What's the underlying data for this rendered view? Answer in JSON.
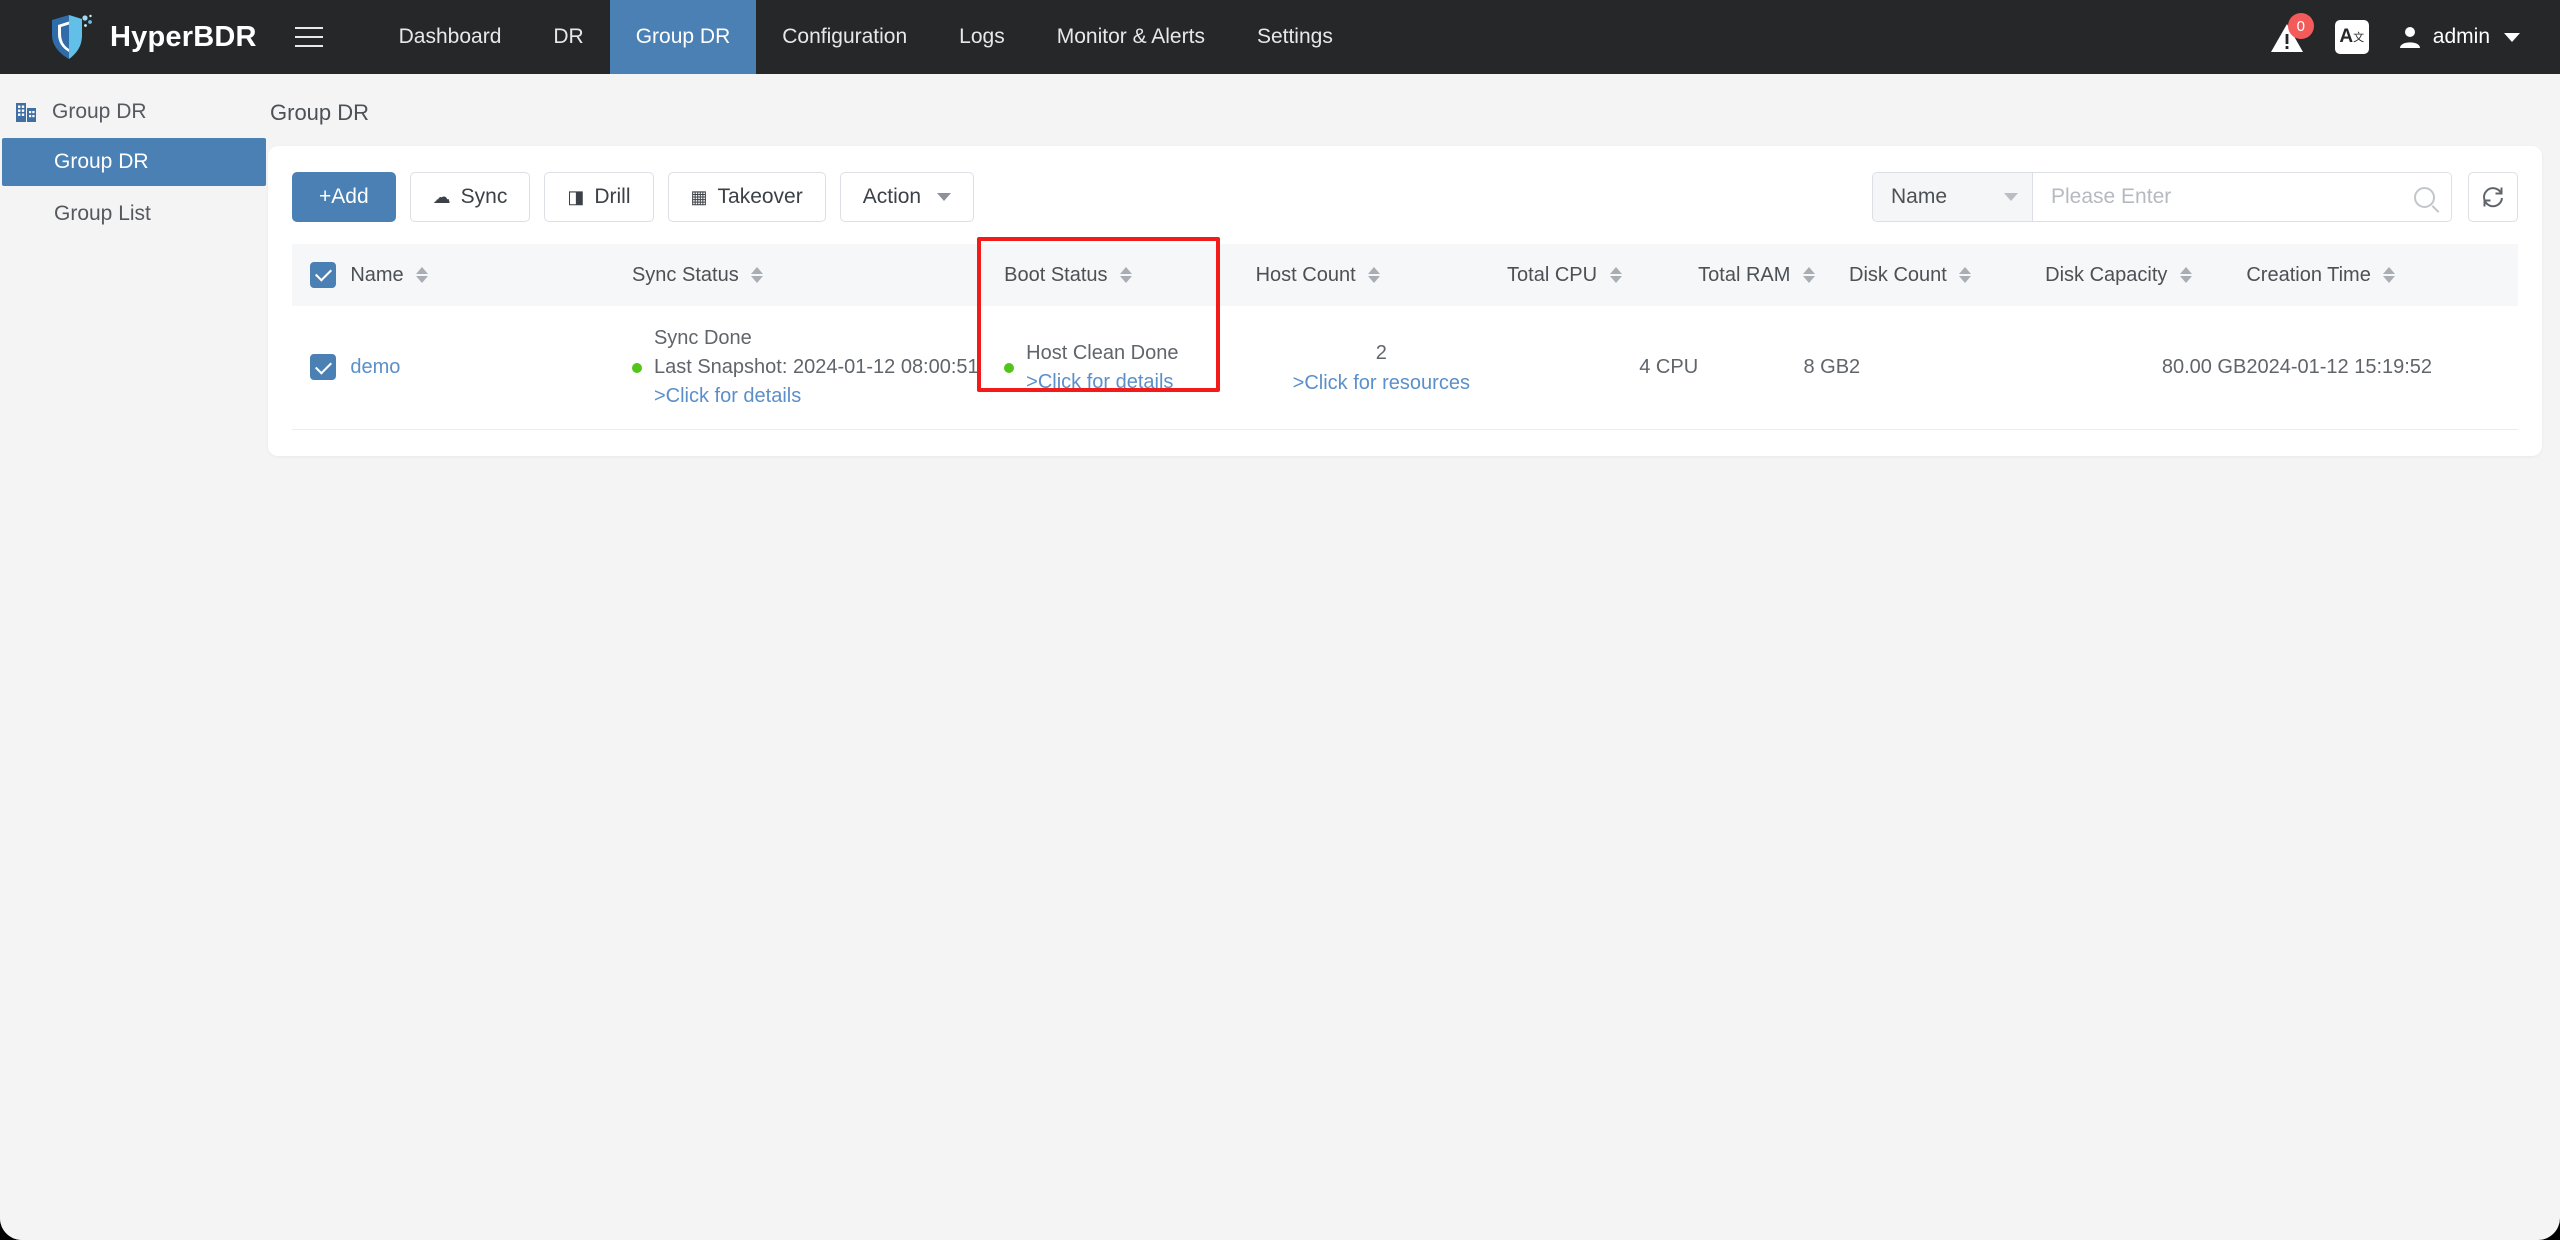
{
  "app": {
    "brand": "HyperBDR",
    "brand_logo_icon": "shield-logo-icon",
    "menu_icon": "hamburger-menu-icon"
  },
  "nav": {
    "items": [
      {
        "label": "Dashboard",
        "active": false
      },
      {
        "label": "DR",
        "active": false
      },
      {
        "label": "Group DR",
        "active": true
      },
      {
        "label": "Configuration",
        "active": false
      },
      {
        "label": "Logs",
        "active": false
      },
      {
        "label": "Monitor & Alerts",
        "active": false
      },
      {
        "label": "Settings",
        "active": false
      }
    ]
  },
  "topbar_right": {
    "alert_icon": "alert-triangle-icon",
    "alert_badge": "0",
    "language_icon": "translate-icon",
    "language_glyph": "A",
    "language_sup": "文",
    "user_icon": "user-avatar-icon",
    "user_name": "admin"
  },
  "sidebar": {
    "header": {
      "label": "Group DR",
      "icon": "building-icon"
    },
    "items": [
      {
        "label": "Group DR",
        "active": true
      },
      {
        "label": "Group List",
        "active": false
      }
    ]
  },
  "page": {
    "title": "Group DR"
  },
  "toolbar": {
    "add_label": "+Add",
    "sync_label": "Sync",
    "sync_icon": "cloud-icon",
    "drill_label": "Drill",
    "drill_icon": "drill-icon",
    "takeover_label": "Takeover",
    "takeover_icon": "takeover-icon",
    "action_label": "Action",
    "action_chevron_icon": "chevron-down-icon"
  },
  "search": {
    "field_label": "Name",
    "placeholder": "Please Enter",
    "value": "",
    "search_icon": "search-icon",
    "refresh_icon": "refresh-icon"
  },
  "table": {
    "select_all_checked": true,
    "columns": [
      {
        "key": "name",
        "label": "Name",
        "sortable": true
      },
      {
        "key": "sync",
        "label": "Sync Status",
        "sortable": true
      },
      {
        "key": "boot",
        "label": "Boot Status",
        "sortable": true
      },
      {
        "key": "host",
        "label": "Host Count",
        "sortable": true
      },
      {
        "key": "cpu",
        "label": "Total CPU",
        "sortable": true
      },
      {
        "key": "ram",
        "label": "Total RAM",
        "sortable": true
      },
      {
        "key": "dcount",
        "label": "Disk Count",
        "sortable": true
      },
      {
        "key": "dcap",
        "label": "Disk Capacity",
        "sortable": true
      },
      {
        "key": "time",
        "label": "Creation Time",
        "sortable": true
      }
    ],
    "rows": [
      {
        "checked": true,
        "name": "demo",
        "sync_status_line1": "Sync Done",
        "sync_status_line2": "Last Snapshot: 2024-01-12 08:00:51",
        "sync_details_link": ">Click for details",
        "sync_dot_color": "#52c41a",
        "boot_status": "Host Clean Done",
        "boot_details_link": ">Click for details",
        "boot_dot_color": "#52c41a",
        "host_count": "2",
        "host_resources_link": ">Click for resources",
        "total_cpu": "4 CPU",
        "total_ram": "8 GB",
        "disk_count": "2",
        "disk_capacity": "80.00 GB",
        "creation_time": "2024-01-12 15:19:52"
      }
    ]
  },
  "annotation": {
    "highlight_color": "#f31a1a",
    "highlight_target": "boot-status-column"
  }
}
